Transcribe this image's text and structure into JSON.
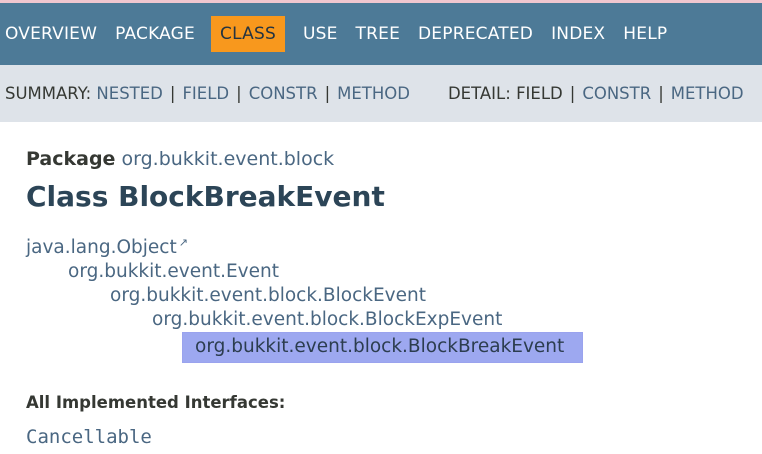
{
  "nav": {
    "items": [
      {
        "label": "OVERVIEW"
      },
      {
        "label": "PACKAGE"
      },
      {
        "label": "CLASS"
      },
      {
        "label": "USE"
      },
      {
        "label": "TREE"
      },
      {
        "label": "DEPRECATED"
      },
      {
        "label": "INDEX"
      },
      {
        "label": "HELP"
      }
    ],
    "active": "CLASS"
  },
  "subnav": {
    "summary_label": "SUMMARY:",
    "summary_links": [
      "NESTED",
      "FIELD",
      "CONSTR",
      "METHOD"
    ],
    "detail_label": "DETAIL:",
    "detail_plain": "FIELD",
    "detail_links": [
      "CONSTR",
      "METHOD"
    ],
    "separator": "|"
  },
  "header": {
    "package_label": "Package",
    "package_name": "org.bukkit.event.block",
    "title": "Class BlockBreakEvent"
  },
  "inheritance": [
    {
      "name": "java.lang.Object",
      "external": true
    },
    {
      "name": "org.bukkit.event.Event"
    },
    {
      "name": "org.bukkit.event.block.BlockEvent"
    },
    {
      "name": "org.bukkit.event.block.BlockExpEvent"
    },
    {
      "name": "org.bukkit.event.block.BlockBreakEvent",
      "current": true
    }
  ],
  "interfaces": {
    "label": "All Implemented Interfaces:",
    "items": [
      "Cancellable"
    ]
  },
  "colors": {
    "nav_bg": "#4d7a97",
    "active_tab": "#f8981d",
    "subnav_bg": "#dee3e9",
    "link": "#4a6782",
    "highlight": "#9da8f0"
  }
}
